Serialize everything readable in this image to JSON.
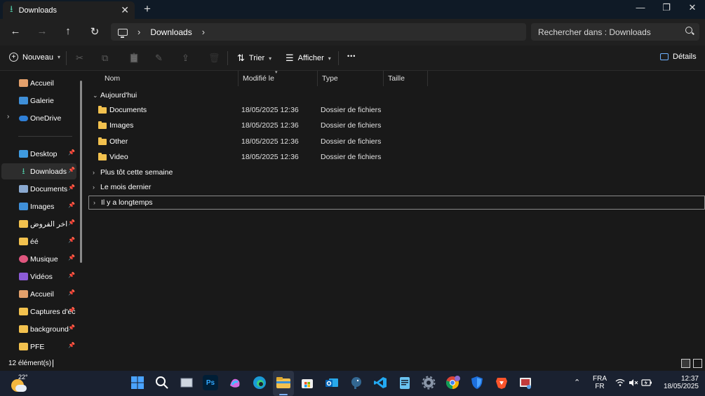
{
  "tab": {
    "title": "Downloads",
    "close_glyph": "✕",
    "new_tab_glyph": "+"
  },
  "window_controls": {
    "minimize": "—",
    "restore": "❐",
    "close": "✕"
  },
  "nav": {
    "back": "←",
    "forward": "→",
    "up": "↑",
    "refresh": "↻"
  },
  "address": {
    "crumbs": [
      "Downloads"
    ],
    "chevron": "›"
  },
  "search": {
    "placeholder": "Rechercher dans : Downloads"
  },
  "commands": {
    "new_label": "Nouveau",
    "cut_icon": "✂",
    "copy_icon": "⧉",
    "paste_icon": "📋",
    "rename_icon": "✎",
    "share_icon": "⇪",
    "delete_icon": "🗑",
    "sort_label": "Trier",
    "view_label": "Afficher",
    "more_glyph": "•••",
    "details_label": "Détails"
  },
  "sidebar": {
    "items": [
      {
        "label": "Accueil",
        "icon": "home-icon"
      },
      {
        "label": "Galerie",
        "icon": "gallery-icon"
      },
      {
        "label": "OneDrive",
        "icon": "cloud-icon"
      },
      {
        "label": "Desktop",
        "icon": "desktop-icon"
      },
      {
        "label": "Downloads",
        "icon": "download-icon"
      },
      {
        "label": "Documents",
        "icon": "document-icon"
      },
      {
        "label": "Images",
        "icon": "image-icon"
      },
      {
        "label": "اخر الفروض",
        "icon": "folder-icon"
      },
      {
        "label": "éé",
        "icon": "folder-icon"
      },
      {
        "label": "Musique",
        "icon": "music-icon"
      },
      {
        "label": "Vidéos",
        "icon": "video-icon"
      },
      {
        "label": "Accueil",
        "icon": "home-icon"
      },
      {
        "label": "Captures d'éc",
        "icon": "folder-icon"
      },
      {
        "label": "background",
        "icon": "folder-icon"
      },
      {
        "label": "PFE",
        "icon": "folder-icon"
      }
    ],
    "pin_glyph": "📌",
    "expander_glyph": "›"
  },
  "columns": {
    "name": "Nom",
    "modified": "Modifié le",
    "type": "Type",
    "size": "Taille"
  },
  "groups": {
    "today": "Aujourd'hui",
    "this_week": "Plus tôt cette semaine",
    "last_month": "Le mois dernier",
    "long_ago": "Il y a longtemps"
  },
  "files": [
    {
      "name": "Documents",
      "modified": "18/05/2025 12:36",
      "type": "Dossier de fichiers"
    },
    {
      "name": "Images",
      "modified": "18/05/2025 12:36",
      "type": "Dossier de fichiers"
    },
    {
      "name": "Other",
      "modified": "18/05/2025 12:36",
      "type": "Dossier de fichiers"
    },
    {
      "name": "Video",
      "modified": "18/05/2025 12:36",
      "type": "Dossier de fichiers"
    }
  ],
  "status": {
    "count": "12 élément(s)"
  },
  "taskbar": {
    "weather_temp": "22°",
    "apps": [
      "start",
      "search",
      "task-view",
      "photoshop",
      "copilot",
      "edge",
      "file-explorer",
      "store",
      "outlook",
      "postgresql",
      "vscode",
      "notepad",
      "settings",
      "chrome",
      "defender",
      "brave",
      "snipping"
    ],
    "ps_text": "Ps",
    "lang_top": "FRA",
    "lang_bottom": "FR",
    "time": "12:37",
    "date": "18/05/2025"
  }
}
